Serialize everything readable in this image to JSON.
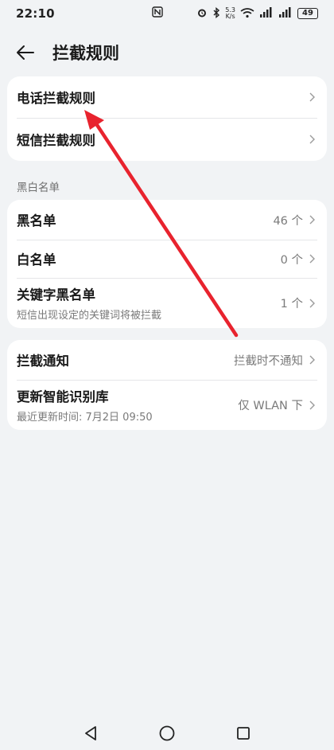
{
  "status_bar": {
    "time": "22:10",
    "nfc_label": "N",
    "speed_top": "5.3",
    "speed_bottom": "K/s",
    "battery": "49"
  },
  "header": {
    "title": "拦截规则"
  },
  "rules_card": {
    "items": [
      {
        "label": "电话拦截规则"
      },
      {
        "label": "短信拦截规则"
      }
    ]
  },
  "blackwhite_section": {
    "header": "黑白名单",
    "items": [
      {
        "label": "黑名单",
        "value": "46 个"
      },
      {
        "label": "白名单",
        "value": "0 个"
      },
      {
        "label": "关键字黑名单",
        "subtitle": "短信出现设定的关键词将被拦截",
        "value": "1 个"
      }
    ]
  },
  "notify_card": {
    "items": [
      {
        "label": "拦截通知",
        "value": "拦截时不通知"
      },
      {
        "label": "更新智能识别库",
        "subtitle": "最近更新时间: 7月2日 09:50",
        "value": "仅 WLAN 下"
      }
    ]
  },
  "colors": {
    "background": "#f1f3f5",
    "card": "#ffffff",
    "annotation_arrow": "#e8232e"
  },
  "icons": {
    "back": "back-arrow-icon",
    "chevron": "chevron-right-icon",
    "nav_back": "nav-back-triangle-icon",
    "nav_home": "nav-home-circle-icon",
    "nav_recents": "nav-recents-square-icon"
  }
}
